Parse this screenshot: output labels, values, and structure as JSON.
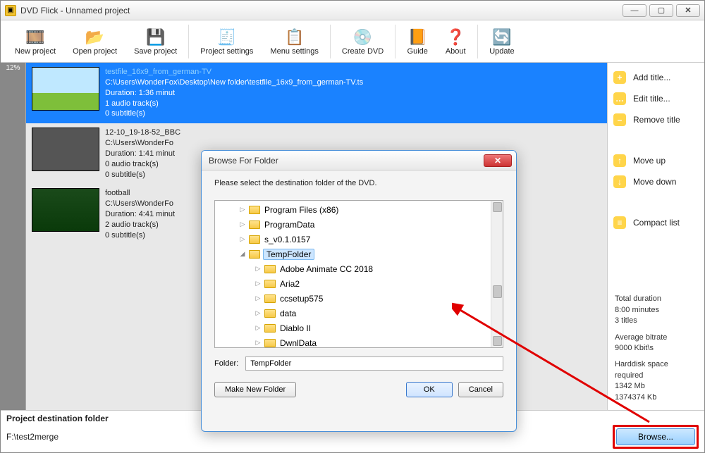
{
  "titlebar": {
    "title": "DVD Flick - Unnamed project"
  },
  "toolbar": {
    "newproject": "New project",
    "openproject": "Open project",
    "saveproject": "Save project",
    "projectsettings": "Project settings",
    "menusettings": "Menu settings",
    "createdvd": "Create DVD",
    "guide": "Guide",
    "about": "About",
    "update": "Update"
  },
  "gauge": "12%",
  "titles": [
    {
      "name": "testfile_16x9_from_german-TV",
      "path": "C:\\Users\\WonderFox\\Desktop\\New folder\\testfile_16x9_from_german-TV.ts",
      "duration": "Duration: 1:36 minut",
      "audio": "1 audio track(s)",
      "subs": "0 subtitle(s)"
    },
    {
      "name": "12-10_19-18-52_BBC",
      "path": "C:\\Users\\WonderFo",
      "duration": "Duration: 1:41 minut",
      "audio": "0 audio track(s)",
      "subs": "0 subtitle(s)"
    },
    {
      "name": "football",
      "path": "C:\\Users\\WonderFo",
      "duration": "Duration: 4:41 minut",
      "audio": "2 audio track(s)",
      "subs": "0 subtitle(s)"
    }
  ],
  "sidebar": {
    "addtitle": "Add title...",
    "edittitle": "Edit title...",
    "removetitle": "Remove title",
    "moveup": "Move up",
    "movedown": "Move down",
    "compactlist": "Compact list"
  },
  "stats": {
    "dur_label": "Total duration",
    "dur_value": "8:00 minutes",
    "titles_value": "3 titles",
    "br_label": "Average bitrate",
    "br_value": "9000 Kbit\\s",
    "hd_label": "Harddisk space required",
    "hd_v1": "1342 Mb",
    "hd_v2": "1374374 Kb"
  },
  "footer": {
    "label": "Project destination folder",
    "path": "F:\\test2merge",
    "browse": "Browse..."
  },
  "dialog": {
    "title": "Browse For Folder",
    "message": "Please select the destination folder of the DVD.",
    "tree": [
      {
        "indent": 1,
        "expander": "▷",
        "label": "Program Files (x86)",
        "selected": false
      },
      {
        "indent": 1,
        "expander": "▷",
        "label": "ProgramData",
        "selected": false
      },
      {
        "indent": 1,
        "expander": "▷",
        "label": "s_v0.1.0157",
        "selected": false
      },
      {
        "indent": 1,
        "expander": "◢",
        "label": "TempFolder",
        "selected": true
      },
      {
        "indent": 2,
        "expander": "▷",
        "label": "Adobe Animate CC 2018",
        "selected": false
      },
      {
        "indent": 2,
        "expander": "▷",
        "label": "Aria2",
        "selected": false
      },
      {
        "indent": 2,
        "expander": "▷",
        "label": "ccsetup575",
        "selected": false
      },
      {
        "indent": 2,
        "expander": "▷",
        "label": "data",
        "selected": false
      },
      {
        "indent": 2,
        "expander": "▷",
        "label": "Diablo II",
        "selected": false
      },
      {
        "indent": 2,
        "expander": "▷",
        "label": "DwnlData",
        "selected": false
      }
    ],
    "folder_label": "Folder:",
    "folder_value": "TempFolder",
    "makenew": "Make New Folder",
    "ok": "OK",
    "cancel": "Cancel"
  }
}
